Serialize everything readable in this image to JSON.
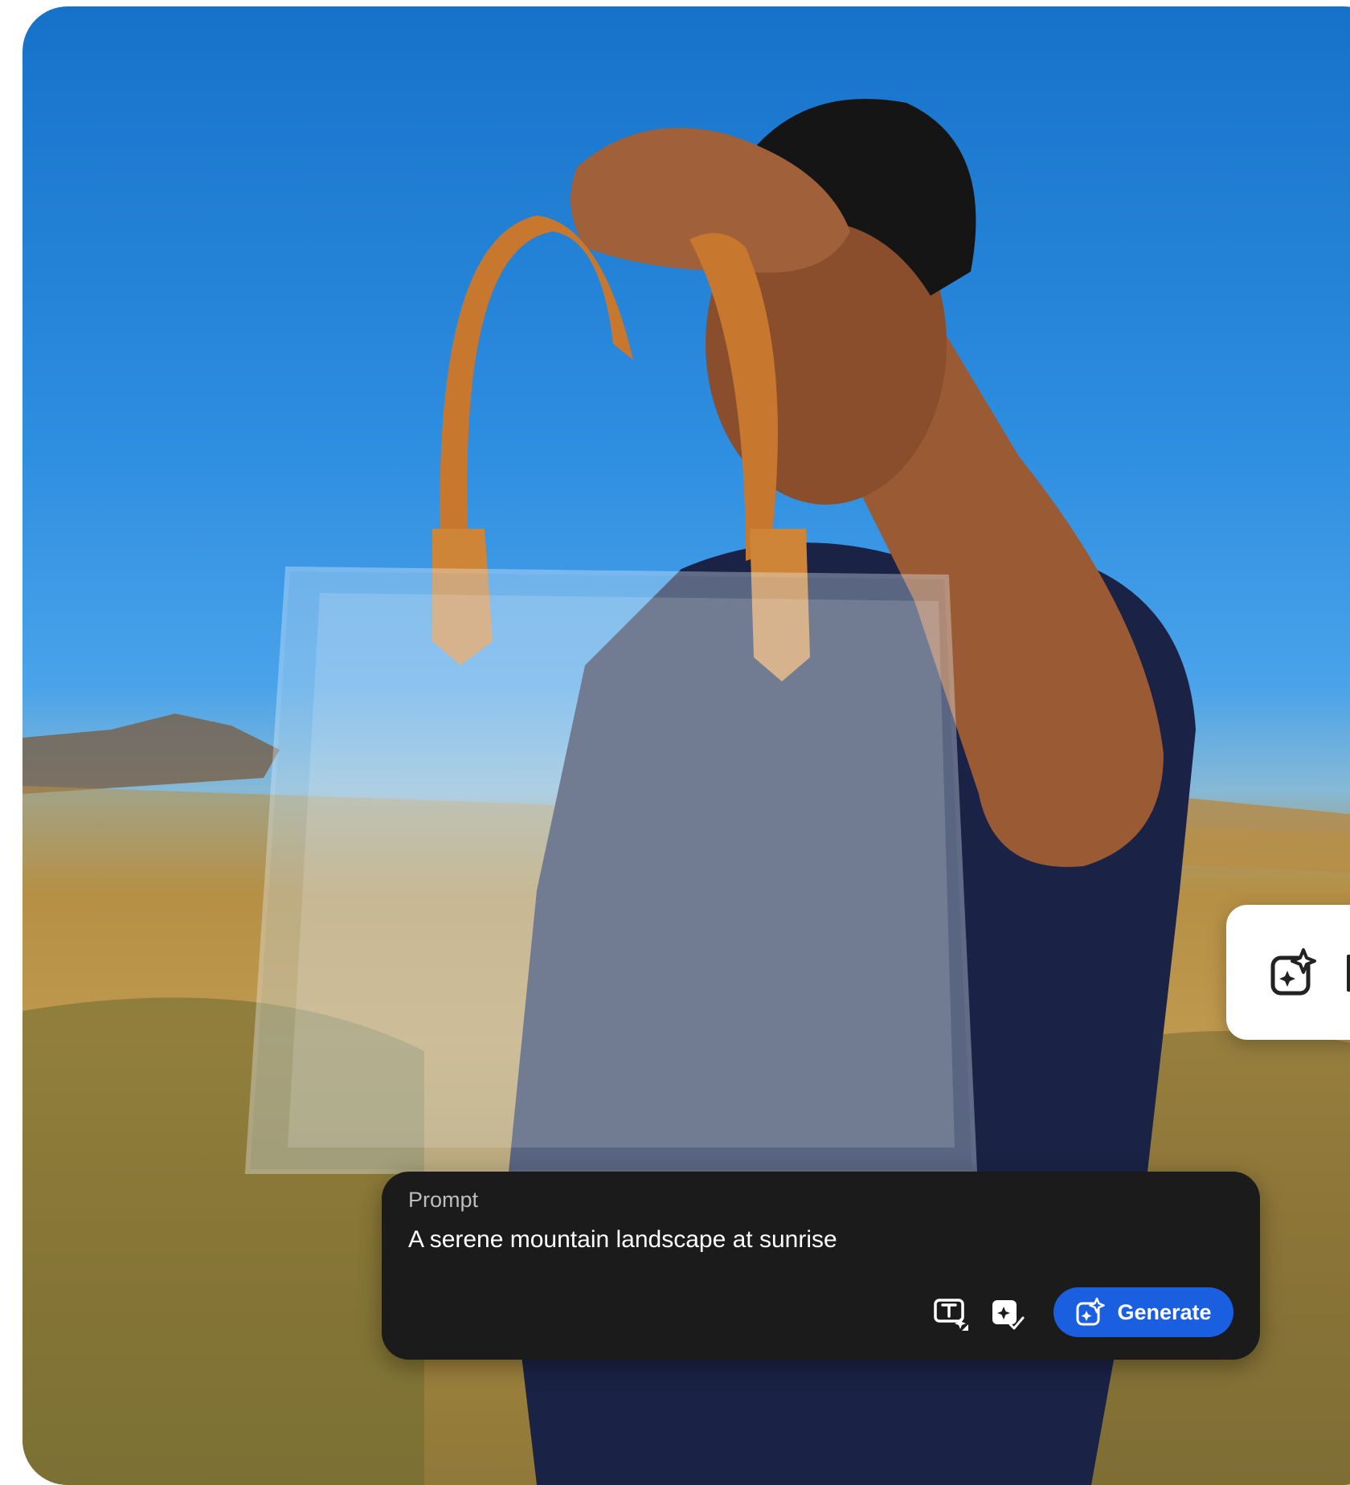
{
  "prompt_panel": {
    "label": "Prompt",
    "text": "A serene mountain landscape at sunrise",
    "generate_label": "Generate"
  },
  "icons": {
    "text_effects": "text-effects-icon",
    "style_reference": "style-reference-icon",
    "generate": "generate-sparkle-icon",
    "side_card": "generate-sparkle-icon"
  },
  "colors": {
    "panel_bg": "#1b1b1b",
    "generate_button": "#1a5fe0",
    "sky": "#1672c9"
  }
}
